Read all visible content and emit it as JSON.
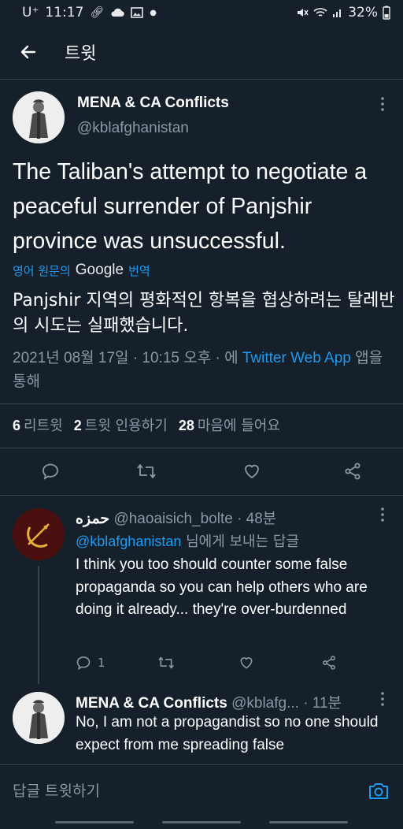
{
  "status_bar": {
    "carrier": "U⁺",
    "time": "11:17",
    "battery": "32%",
    "icons": [
      "link-icon",
      "cloud-icon",
      "image-icon",
      "dot-icon",
      "mute-icon",
      "wifi-icon",
      "signal-icon",
      "battery-icon"
    ]
  },
  "app_bar": {
    "title": "트윗",
    "back_icon": "arrow-left-icon"
  },
  "tweet": {
    "author_name": "MENA & CA Conflicts",
    "author_handle": "@kblafghanistan",
    "text": "The Taliban's attempt to negotiate a peaceful surrender of Panjshir province was unsuccessful.",
    "translate_prefix": "영어 원문의",
    "translate_provider": "Google",
    "translate_suffix": "번역",
    "translated_text": "Panjshir 지역의 평화적인 항복을 협상하려는 탈레반의 시도는 실패했습니다.",
    "timestamp": "2021년 08월 17일 · 10:15 오후 · 에",
    "via": "Twitter Web App",
    "via_suffix": "앱을 통해",
    "retweets_count": "6",
    "retweets_label": "리트윗",
    "quotes_count": "2",
    "quotes_label": "트윗 인용하기",
    "likes_count": "28",
    "likes_label": "마음에 들어요"
  },
  "replies": [
    {
      "name": "حمزه",
      "handle": "@haoaisich_bolte · 48분",
      "replying_to": "@kblafghanistan",
      "replying_suffix": "님에게 보내는 답글",
      "text": "I think you too should counter some false propaganda so you can help others who are doing it already... they're over-burdenned",
      "reply_count": "1"
    },
    {
      "name": "MENA & CA Conflicts",
      "handle": "@kblafg... · 11분",
      "text": "No, I am not a propagandist so no one should expect from me spreading false"
    }
  ],
  "compose": {
    "placeholder": "답글 트윗하기"
  },
  "colors": {
    "background": "#15202b",
    "accent": "#1d9bf0",
    "secondary_text": "#8b98a5",
    "divider": "#38444d"
  }
}
